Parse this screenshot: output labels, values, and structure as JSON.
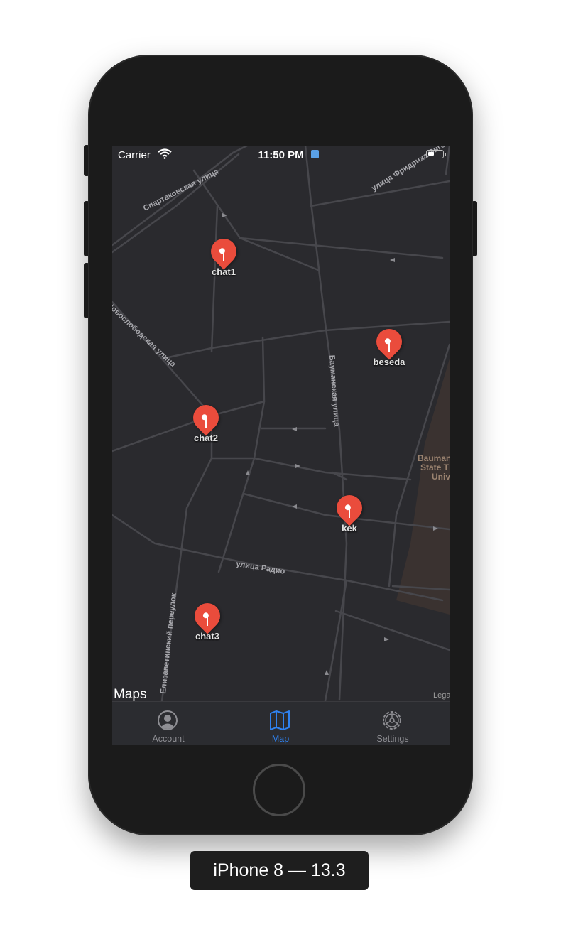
{
  "status_bar": {
    "carrier": "Carrier",
    "time": "11:50 PM",
    "battery_level": 0.45
  },
  "map": {
    "theme": "dark",
    "street_labels": [
      "Спартаковская улица",
      "улица Фридриха Энгельса",
      "Бауманская улица",
      "Новослободская улица",
      "улица Радио",
      "Елизаветинский переулок"
    ],
    "poi_label": {
      "line1": "Bauman",
      "line2": "State T",
      "line3": "Univ"
    },
    "pins": [
      {
        "label": "chat1"
      },
      {
        "label": "beseda"
      },
      {
        "label": "chat2"
      },
      {
        "label": "kek"
      },
      {
        "label": "chat3"
      }
    ],
    "attribution": {
      "logo_text": "Maps",
      "legal": "Legal"
    },
    "colors": {
      "pin": "#ea4c3c",
      "road": "#4a4a4f",
      "background": "#2a2a2e"
    }
  },
  "tab_bar": {
    "tabs": [
      {
        "label": "Account",
        "icon": "account-icon",
        "active": false
      },
      {
        "label": "Map",
        "icon": "map-icon",
        "active": true
      },
      {
        "label": "Settings",
        "icon": "settings-icon",
        "active": false
      }
    ],
    "active_color": "#2f82f0",
    "inactive_color": "#8e8e93"
  },
  "device_caption": "iPhone 8 — 13.3"
}
